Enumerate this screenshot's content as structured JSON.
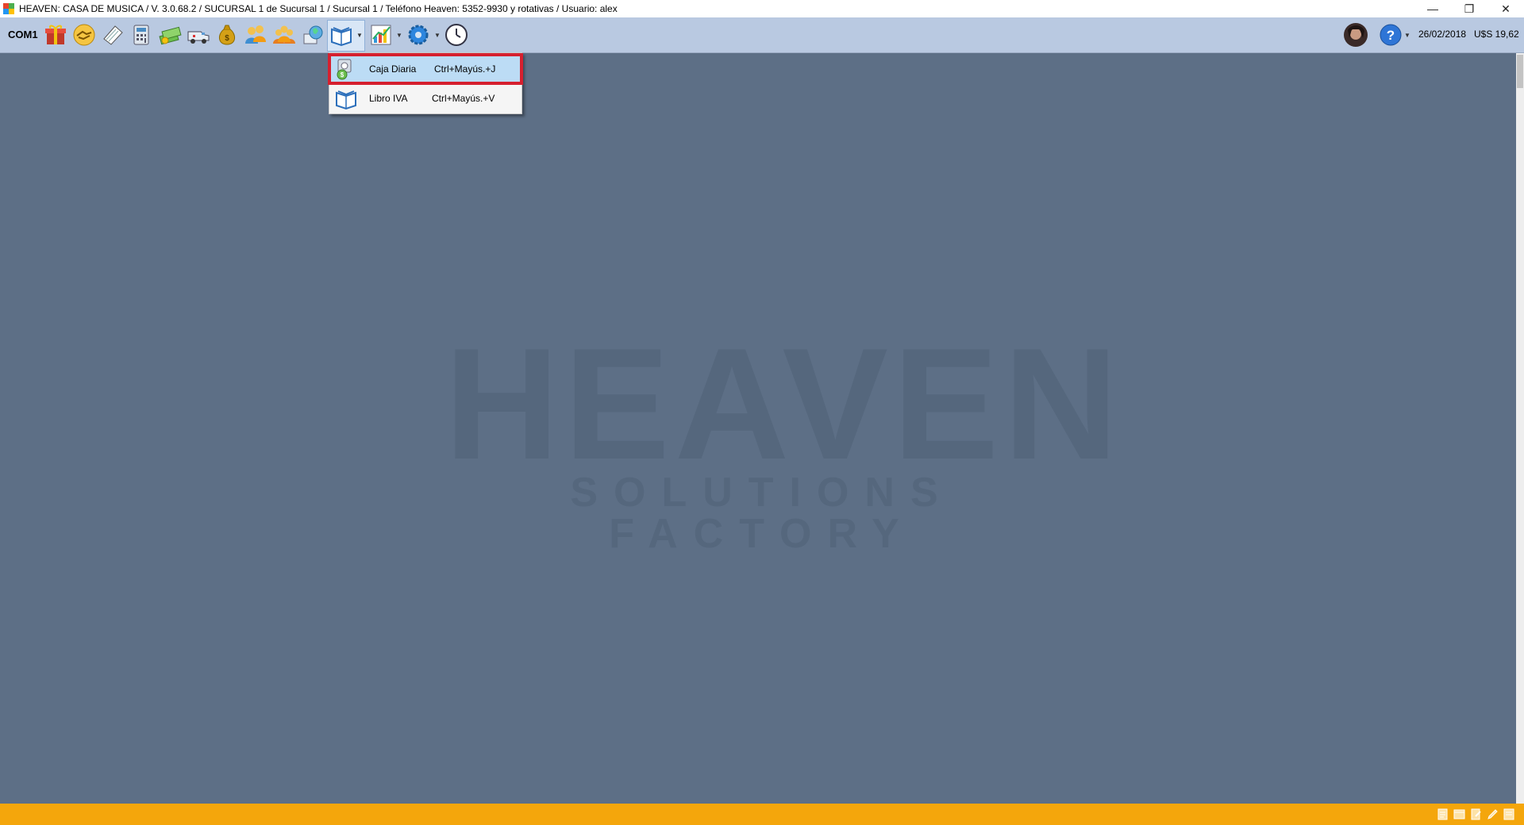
{
  "window": {
    "title": "HEAVEN: CASA DE MUSICA / V. 3.0.68.2 / SUCURSAL 1 de Sucursal 1 / Sucursal 1 / Teléfono Heaven: 5352-9930 y rotativas / Usuario: alex",
    "controls": {
      "minimize": "—",
      "restore": "❐",
      "close": "✕"
    }
  },
  "toolbar": {
    "com_label": "COM1",
    "icons": [
      "gift-icon",
      "handshake-icon",
      "notepad-icon",
      "calculator-icon",
      "money-icon",
      "van-icon",
      "money-bag-icon",
      "users-icon",
      "group-icon",
      "globe-icon",
      "book-icon",
      "chart-icon",
      "gear-icon",
      "clock-icon"
    ],
    "date": "26/02/2018",
    "exchange_rate": "U$S 19,62"
  },
  "dropdown": {
    "items": [
      {
        "label": "Caja Diaria",
        "shortcut": "Ctrl+Mayús.+J",
        "icon": "cash-box-icon",
        "highlighted": true
      },
      {
        "label": "Libro IVA",
        "shortcut": "Ctrl+Mayús.+V",
        "icon": "book-icon",
        "highlighted": false
      }
    ]
  },
  "watermark": {
    "title": "HEAVEN",
    "subtitle": "SOLUTIONS FACTORY"
  },
  "colors": {
    "workspace": "#5d6f86",
    "toolbar": "#b9c9e1",
    "statusbar": "#f4a60c",
    "highlight_border": "#d6202f",
    "highlight_fill": "#bcdcf5"
  }
}
